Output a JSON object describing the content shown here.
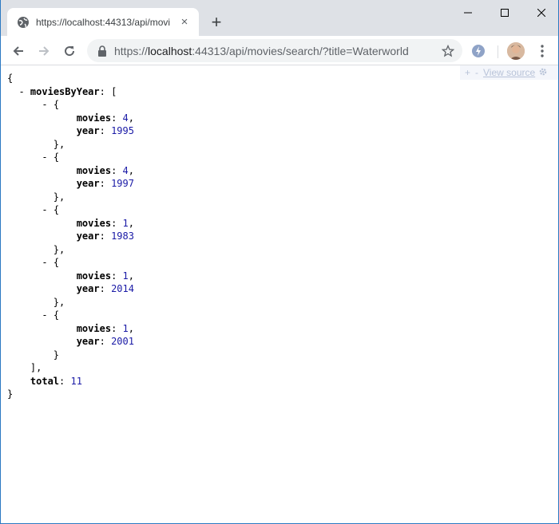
{
  "browser": {
    "tab_title": "https://localhost:44313/api/movi",
    "tab_close": "×",
    "new_tab": "+",
    "url_scheme": "https://",
    "url_host": "localhost",
    "url_rest": ":44313/api/movies/search/?title=Waterworld"
  },
  "json_viewer": {
    "expand": "+",
    "collapse": "-",
    "view_source": "View source"
  },
  "json": {
    "root_key": "moviesByYear",
    "total_key": "total",
    "total": "11",
    "entries": [
      {
        "movies_key": "movies",
        "movies": "4",
        "year_key": "year",
        "year": "1995"
      },
      {
        "movies_key": "movies",
        "movies": "4",
        "year_key": "year",
        "year": "1997"
      },
      {
        "movies_key": "movies",
        "movies": "1",
        "year_key": "year",
        "year": "1983"
      },
      {
        "movies_key": "movies",
        "movies": "1",
        "year_key": "year",
        "year": "2014"
      },
      {
        "movies_key": "movies",
        "movies": "1",
        "year_key": "year",
        "year": "2001"
      }
    ]
  },
  "colors": {
    "number": "#1a1aa6",
    "frame": "#2b79c2",
    "tabstrip": "#dee1e6"
  }
}
